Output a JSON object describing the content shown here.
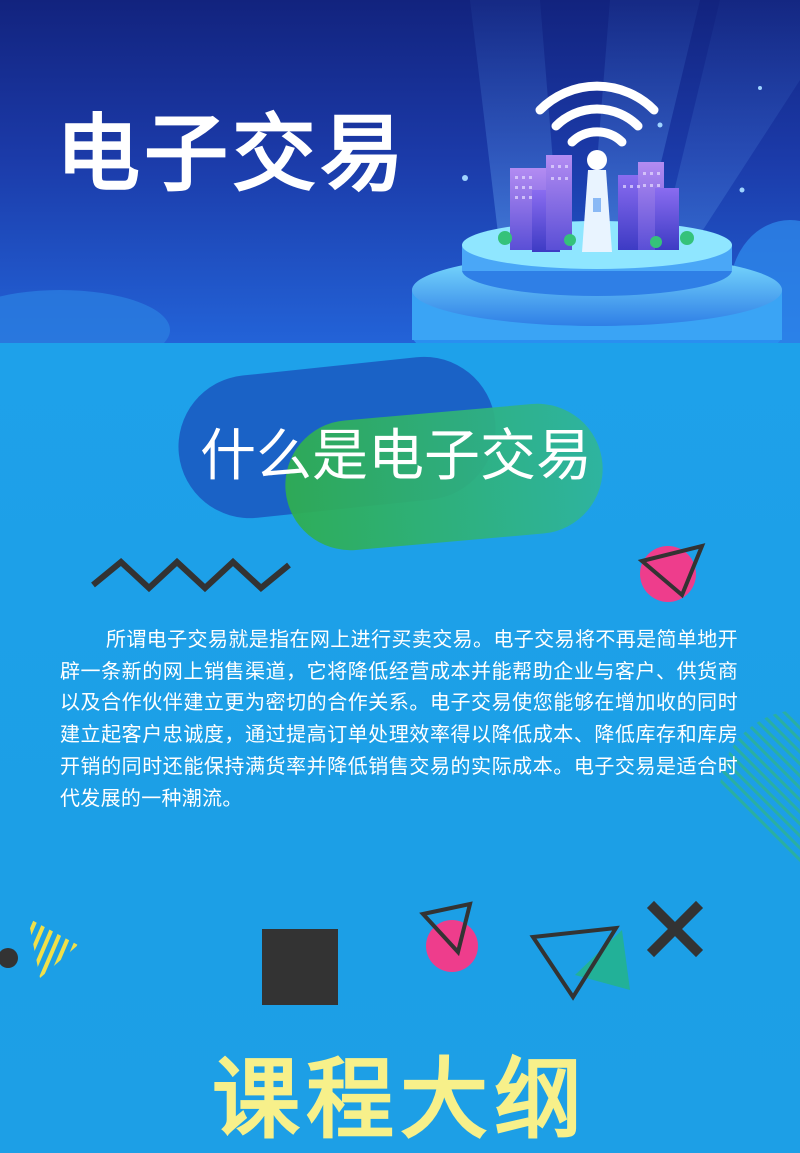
{
  "banner": {
    "title": "电子交易"
  },
  "section": {
    "title": "什么是电子交易",
    "body": "所谓电子交易就是指在网上进行买卖交易。电子交易将不再是简单地开辟一条新的网上销售渠道，它将降低经营成本并能帮助企业与客户、供货商以及合作伙伴建立更为密切的合作关系。电子交易使您能够在增加收的同时建立起客户忠诚度，通过提高订单处理效率得以降低成本、降低库存和库房开销的同时还能保持满货率并降低销售交易的实际成本。电子交易是适合时代发展的一种潮流。"
  },
  "outline": {
    "title": "课程大纲"
  },
  "colors": {
    "banner_dark": "#12237e",
    "main_blue": "#1e9fe8",
    "pill_blue": "#1a5fc4",
    "pill_green": "#2fae4f",
    "pink": "#ee3d8c",
    "dark_gray": "#333333",
    "yellow": "#f7f08a"
  },
  "icons": {
    "wifi": "wifi-icon",
    "zigzag": "zigzag-decoration",
    "cross": "cross-icon"
  }
}
